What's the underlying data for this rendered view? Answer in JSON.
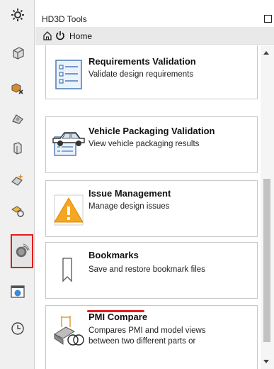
{
  "window": {
    "title": "HD3D Tools"
  },
  "nav": {
    "home_label": "Home"
  },
  "tools": [
    {
      "title": "Requirements Validation",
      "description": "Validate design requirements",
      "icon": "requirements-icon"
    },
    {
      "title": "Vehicle Packaging Validation",
      "description": "View vehicle packaging results",
      "icon": "vehicle-icon"
    },
    {
      "title": "Issue Management",
      "description": "Manage design issues",
      "icon": "warning-icon"
    },
    {
      "title": "Bookmarks",
      "description": "Save and restore bookmark files",
      "icon": "bookmark-icon"
    },
    {
      "title": "PMI Compare",
      "description": "Compares PMI and model views between two different parts or",
      "icon": "pmi-compare-icon"
    }
  ],
  "rail_icons": [
    "settings-icon",
    "part-icon",
    "assembly-navigator-icon",
    "constraint-navigator-icon",
    "part-navigator-icon",
    "reuse-library-icon",
    "hd3d-tools-icon",
    "web-browser-icon",
    "history-icon",
    "role-icon"
  ],
  "colors": {
    "highlight": "#e21b1b"
  }
}
